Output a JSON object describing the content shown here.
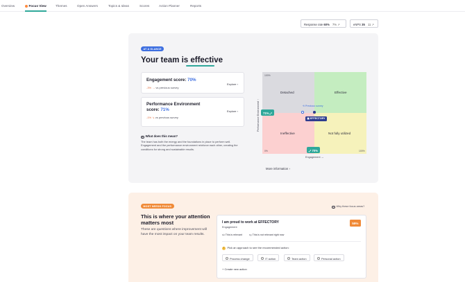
{
  "tabs": [
    "Overview",
    "Focus View",
    "Themes",
    "Open Answers",
    "Topics & Ideas",
    "Scores",
    "Action Planner",
    "Reports"
  ],
  "active_tab": "Focus View",
  "metrics": {
    "response_rate": {
      "label": "Response rate",
      "value": "60%",
      "delta": "7%"
    },
    "enps": {
      "label": "eNPS",
      "value": "35",
      "delta": "11"
    }
  },
  "glance": {
    "badge": "AT A GLANCE",
    "title_prefix": "Your team is",
    "title_highlight": "effective",
    "engagement": {
      "label": "Engagement score:",
      "value": "70%",
      "delta": "-3%",
      "compare": "vs previous survey",
      "explore": "Explore"
    },
    "performance": {
      "label_line1": "Performance Environment",
      "label_line2": "score:",
      "value": "71%",
      "delta": "-1%",
      "compare": "vs previous survey",
      "explore": "Explore"
    },
    "what_question": "What does this mean?",
    "what_answer": "The team has both the energy and the foundations in place to perform well. Engagement and the performance environment reinforce each other, creating the conditions for strong and sustainable results.",
    "more_info": "More information"
  },
  "matrix": {
    "quadrants": {
      "top_left": {
        "label": "Detached",
        "color": "#dadadf"
      },
      "top_right": {
        "label": "Effective",
        "color": "#c4edc0"
      },
      "bottom_left": {
        "label": "Ineffective",
        "color": "#fcd0d0"
      },
      "bottom_right": {
        "label": "Not fully utilized",
        "color": "#f6f2bb"
      }
    },
    "tick_top": "100%",
    "tick_origin": "0%",
    "tick_right": "100%",
    "y_label": "Performance Environment",
    "x_label": "Engagement",
    "y_marker": "71%",
    "x_marker": "70%",
    "previous_tag": "Previous survey",
    "effectory_tag": "EFFECTORY"
  },
  "focus": {
    "badge": "MOST NEEDS FOCUS",
    "title": "This is where your attention matters most",
    "description": "These are questions where improvement will have the most impact on your team results.",
    "why": "Why these focus areas?",
    "question": {
      "title": "I am proud to work at EFFECTORY",
      "category": "Engagement",
      "score": "59%",
      "relevant": "This is relevant",
      "not_relevant": "This is not relevant right now",
      "pick": "Pick an approach to see the recommended action:",
      "options": [
        "Process change",
        "IT action",
        "Team action",
        "Personal action"
      ],
      "create": "Create new action"
    }
  }
}
